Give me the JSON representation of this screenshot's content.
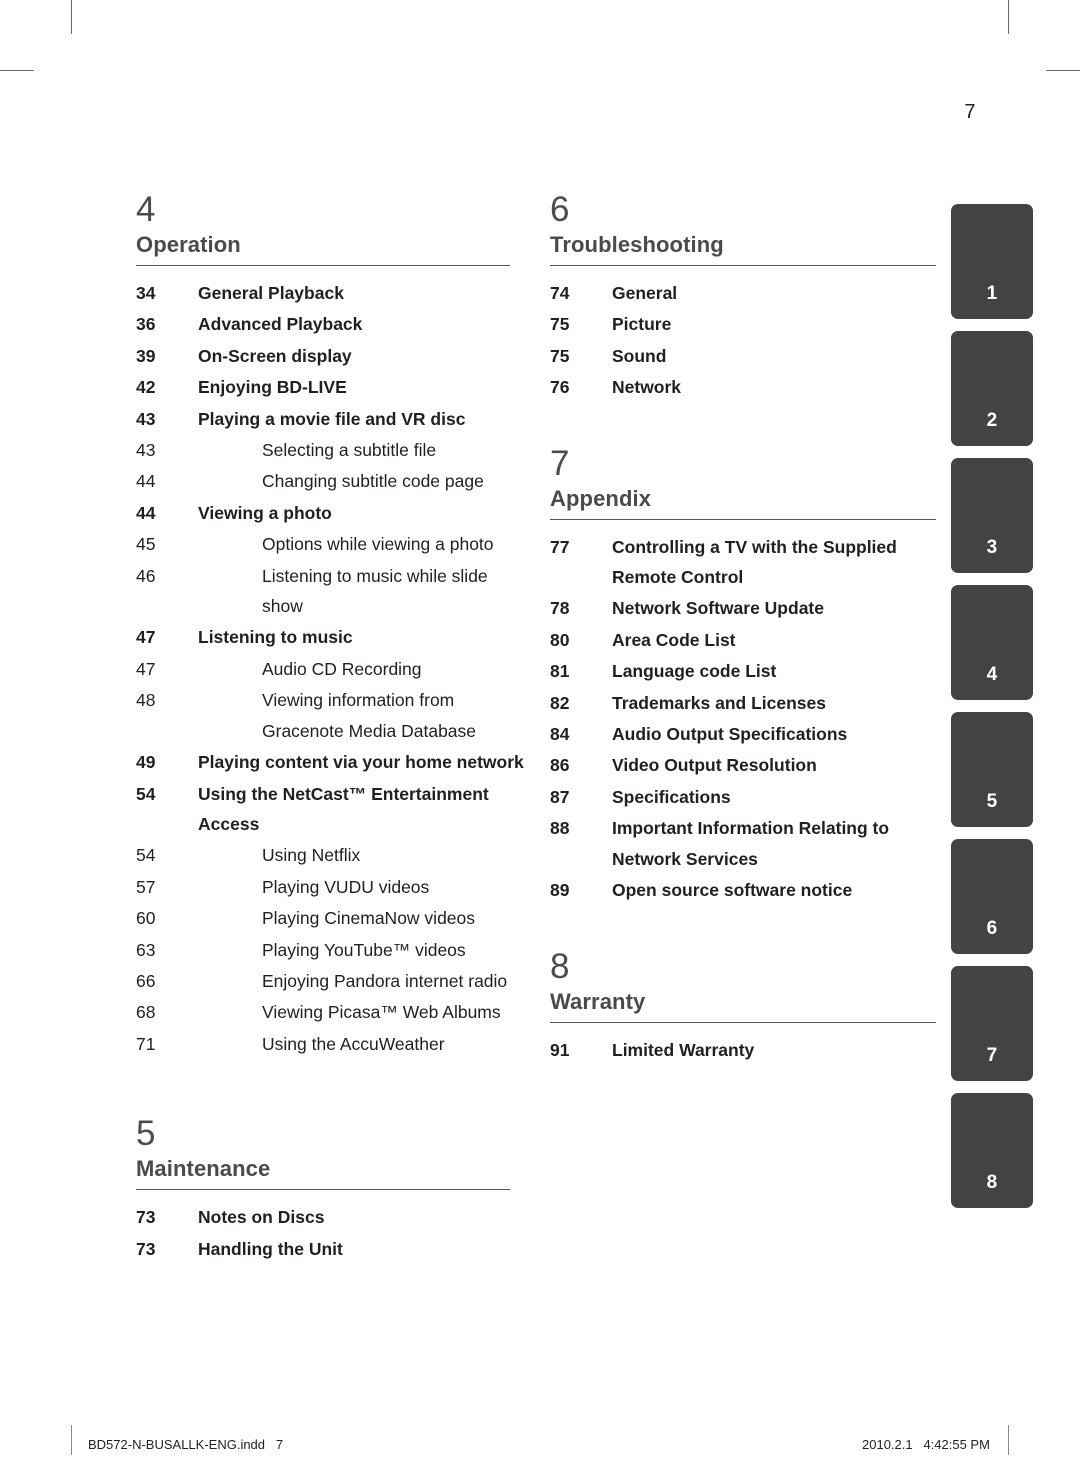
{
  "page": {
    "folio": "7",
    "footer_left": "BD572-N-BUSALLK-ENG.indd   7",
    "footer_right": "2010.2.1   4:42:55 PM"
  },
  "columns": {
    "left": [
      {
        "number": "4",
        "title": "Operation",
        "entries": [
          {
            "page": "34",
            "label": "General Playback",
            "level": 1
          },
          {
            "page": "36",
            "label": "Advanced Playback",
            "level": 1
          },
          {
            "page": "39",
            "label": "On-Screen display",
            "level": 1
          },
          {
            "page": "42",
            "label": "Enjoying BD-LIVE",
            "level": 1
          },
          {
            "page": "43",
            "label": "Playing a movie file and VR disc",
            "level": 1
          },
          {
            "page": "43",
            "label": "Selecting a subtitle file",
            "level": 2
          },
          {
            "page": "44",
            "label": "Changing subtitle code page",
            "level": 2
          },
          {
            "page": "44",
            "label": "Viewing a photo",
            "level": 1
          },
          {
            "page": "45",
            "label": "Options while viewing a photo",
            "level": 2
          },
          {
            "page": "46",
            "label": "Listening to music while slide show",
            "level": 2
          },
          {
            "page": "47",
            "label": "Listening to music",
            "level": 1
          },
          {
            "page": "47",
            "label": "Audio CD Recording",
            "level": 2
          },
          {
            "page": "48",
            "label": "Viewing information from Gracenote Media Database",
            "level": 2
          },
          {
            "page": "49",
            "label": "Playing content via your home network",
            "level": 1
          },
          {
            "page": "54",
            "label": "Using the NetCast™ Entertainment Access",
            "level": 1
          },
          {
            "page": "54",
            "label": "Using Netflix",
            "level": 2
          },
          {
            "page": "57",
            "label": "Playing VUDU videos",
            "level": 2
          },
          {
            "page": "60",
            "label": "Playing CinemaNow videos",
            "level": 2
          },
          {
            "page": "63",
            "label": "Playing YouTube™ videos",
            "level": 2
          },
          {
            "page": "66",
            "label": "Enjoying Pandora internet radio",
            "level": 2
          },
          {
            "page": "68",
            "label": "Viewing Picasa™ Web Albums",
            "level": 2
          },
          {
            "page": "71",
            "label": "Using the AccuWeather",
            "level": 2
          }
        ]
      },
      {
        "number": "5",
        "title": "Maintenance",
        "entries": [
          {
            "page": "73",
            "label": "Notes on Discs",
            "level": 1
          },
          {
            "page": "73",
            "label": "Handling the Unit",
            "level": 1
          }
        ]
      }
    ],
    "right": [
      {
        "number": "6",
        "title": "Troubleshooting",
        "entries": [
          {
            "page": "74",
            "label": "General",
            "level": 1
          },
          {
            "page": "75",
            "label": "Picture",
            "level": 1
          },
          {
            "page": "75",
            "label": "Sound",
            "level": 1
          },
          {
            "page": "76",
            "label": "Network",
            "level": 1
          }
        ]
      },
      {
        "number": "7",
        "title": "Appendix",
        "entries": [
          {
            "page": "77",
            "label": "Controlling a TV with the Supplied Remote Control",
            "level": 1
          },
          {
            "page": "78",
            "label": "Network Software Update",
            "level": 1
          },
          {
            "page": "80",
            "label": "Area Code List",
            "level": 1
          },
          {
            "page": "81",
            "label": "Language code List",
            "level": 1
          },
          {
            "page": "82",
            "label": "Trademarks and Licenses",
            "level": 1
          },
          {
            "page": "84",
            "label": "Audio Output Specifications",
            "level": 1
          },
          {
            "page": "86",
            "label": "Video Output Resolution",
            "level": 1
          },
          {
            "page": "87",
            "label": "Specifications",
            "level": 1
          },
          {
            "page": "88",
            "label": "Important Information Relating to Network Services",
            "level": 1
          },
          {
            "page": "89",
            "label": "Open source software notice",
            "level": 1
          }
        ]
      },
      {
        "number": "8",
        "title": "Warranty",
        "entries": [
          {
            "page": "91",
            "label": "Limited Warranty",
            "level": 1
          }
        ]
      }
    ]
  },
  "thumb_tabs": {
    "accent_color": "#434343",
    "labels": [
      "1",
      "2",
      "3",
      "4",
      "5",
      "6",
      "7",
      "8"
    ]
  }
}
